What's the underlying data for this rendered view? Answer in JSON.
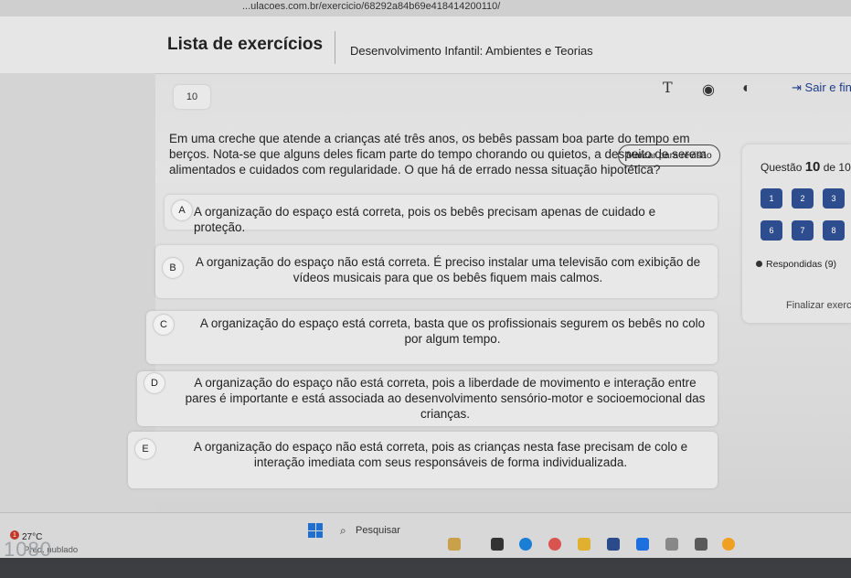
{
  "browser": {
    "url": "...ulacoes.com.br/exercicio/68292a84b69e418414200110/"
  },
  "header": {
    "title": "Lista de exercícios",
    "subject": "Desenvolvimento Infantil: Ambientes e Teorias",
    "exit_label": "Sair e fin"
  },
  "question": {
    "number": "10",
    "review_label": "Marcar para revisão",
    "stem": "Em uma creche que atende a crianças até três anos, os bebês passam boa parte do tempo em berços. Nota-se que alguns deles ficam parte do tempo chorando ou quietos, a despeito de serem alimentados e cuidados com regularidade. O que há de errado nessa situação hipotética?",
    "options": [
      {
        "letter": "A",
        "text": "A organização do espaço está correta, pois os bebês precisam apenas de cuidado e proteção."
      },
      {
        "letter": "B",
        "text": "A organização do espaço não está correta. É preciso instalar uma televisão com exibição de vídeos musicais para que os bebês fiquem mais calmos."
      },
      {
        "letter": "C",
        "text": "A organização do espaço está correta, basta que os profissionais segurem os bebês no colo por algum tempo."
      },
      {
        "letter": "D",
        "text": "A organização do espaço não está correta, pois a liberdade de movimento e interação entre pares é importante e está associada ao desenvolvimento sensório-motor e socioemocional das crianças."
      },
      {
        "letter": "E",
        "text": "A organização do espaço não está correta, pois as crianças nesta fase precisam de colo e interação imediata com seus responsáveis de forma individualizada."
      }
    ]
  },
  "panel": {
    "question_prefix": "Questão",
    "current": "10",
    "total_text": "de 10",
    "buttons": [
      "1",
      "2",
      "3",
      "6",
      "7",
      "8"
    ],
    "answered_label": "Respondidas (9)",
    "finish_label": "Finalizar exerc"
  },
  "taskbar": {
    "weather_temp": "27°C",
    "weather_desc": "Pred. nublado",
    "alert_count": "1",
    "search_label": "Pesquisar"
  },
  "bezel": {
    "text": "1080"
  },
  "colors": {
    "accent": "#2d4d8e",
    "link": "#1f3c8a"
  }
}
